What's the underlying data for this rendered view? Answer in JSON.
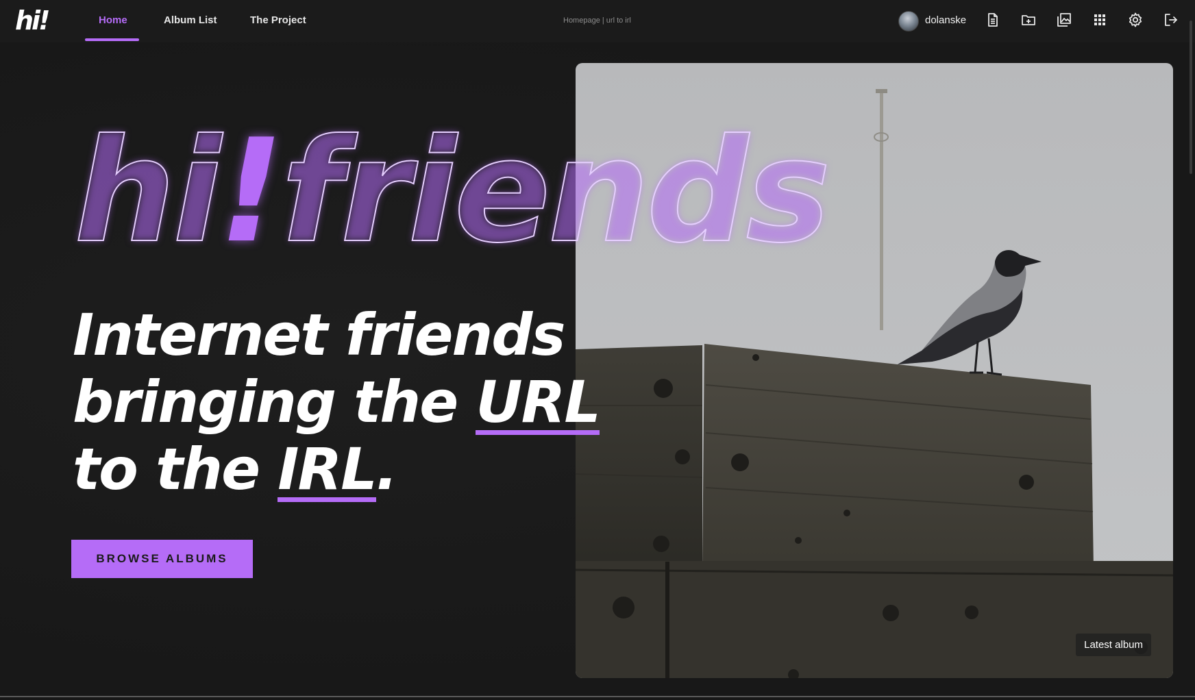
{
  "nav": {
    "logo": "hi!",
    "links": [
      {
        "label": "Home",
        "active": true
      },
      {
        "label": "Album List"
      },
      {
        "label": "The Project"
      }
    ],
    "center_text": "Homepage | url to irl",
    "username": "dolanske",
    "icons": [
      "document-icon",
      "folder-add-icon",
      "images-icon",
      "grid-icon",
      "gear-icon",
      "logout-icon"
    ]
  },
  "hero": {
    "title_part1": "hi",
    "title_bang": "!",
    "title_part2": "friends",
    "tagline_line1": "Internet friends",
    "tagline_line2_prefix": "bringing the ",
    "tagline_line2_highlight": "URL",
    "tagline_line3_prefix": "to the ",
    "tagline_line3_highlight": "IRL",
    "tagline_line3_suffix": ".",
    "button_label": "BROWSE ALBUMS"
  },
  "photo": {
    "badge_label": "Latest album"
  },
  "colors": {
    "accent": "#b56cf7",
    "background": "#1a1a1a"
  }
}
